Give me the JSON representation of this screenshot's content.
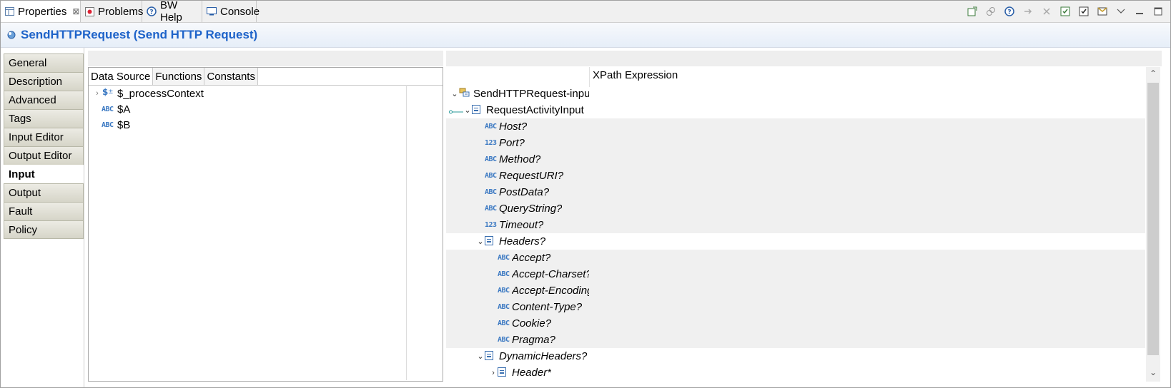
{
  "tabs": [
    {
      "label": "Properties",
      "icon": "properties-icon",
      "closable": true,
      "active": true
    },
    {
      "label": "Problems",
      "icon": "problems-icon",
      "closable": false,
      "active": false
    },
    {
      "label": "BW Help",
      "icon": "help-icon",
      "closable": false,
      "active": false
    },
    {
      "label": "Console",
      "icon": "console-icon",
      "closable": false,
      "active": false
    }
  ],
  "close_glyph": "⊠",
  "toolbar_icons": [
    "pin-icon",
    "link-icon",
    "help-icon",
    "forward-icon",
    "close-all-icon",
    "save-icon",
    "check-icon",
    "filter-icon",
    "view-menu-icon",
    "minimize-icon",
    "maximize-icon"
  ],
  "title": "SendHTTPRequest (Send HTTP Request)",
  "side_tabs": [
    "General",
    "Description",
    "Advanced",
    "Tags",
    "Input Editor",
    "Output Editor",
    "Input",
    "Output",
    "Fault",
    "Policy"
  ],
  "selected_side_tab": "Input",
  "left_pane": {
    "subtabs": [
      "Data Source",
      "Functions",
      "Constants"
    ],
    "active_subtab": "Data Source",
    "tree": [
      {
        "label": "$_processContext",
        "icon": "context-var-icon",
        "expandable": true
      },
      {
        "label": "$A",
        "icon": "string-type-icon",
        "expandable": false
      },
      {
        "label": "$B",
        "icon": "string-type-icon",
        "expandable": false
      }
    ]
  },
  "right_pane": {
    "column_header": "XPath Expression",
    "type_glyphs": {
      "string": "ABC",
      "number": "123"
    },
    "tree": [
      {
        "label": "SendHTTPRequest-input",
        "type": "root",
        "chev": "⌄",
        "indent": 0,
        "shade": false,
        "italic": false
      },
      {
        "label": "RequestActivityInput",
        "type": "element",
        "chev": "⌄",
        "indent": 1,
        "shade": false,
        "italic": false,
        "mapped": true
      },
      {
        "label": "Host?",
        "type": "string",
        "indent": 2,
        "shade": true,
        "italic": true
      },
      {
        "label": "Port?",
        "type": "number",
        "indent": 2,
        "shade": true,
        "italic": true
      },
      {
        "label": "Method?",
        "type": "string",
        "indent": 2,
        "shade": true,
        "italic": true
      },
      {
        "label": "RequestURI?",
        "type": "string",
        "indent": 2,
        "shade": true,
        "italic": true
      },
      {
        "label": "PostData?",
        "type": "string",
        "indent": 2,
        "shade": true,
        "italic": true
      },
      {
        "label": "QueryString?",
        "type": "string",
        "indent": 2,
        "shade": true,
        "italic": true
      },
      {
        "label": "Timeout?",
        "type": "number",
        "indent": 2,
        "shade": true,
        "italic": true
      },
      {
        "label": "Headers?",
        "type": "element",
        "chev": "⌄",
        "indent": 2,
        "shade": false,
        "italic": true
      },
      {
        "label": "Accept?",
        "type": "string",
        "indent": 3,
        "shade": true,
        "italic": true
      },
      {
        "label": "Accept-Charset?",
        "type": "string",
        "indent": 3,
        "shade": true,
        "italic": true
      },
      {
        "label": "Accept-Encoding?",
        "type": "string",
        "indent": 3,
        "shade": true,
        "italic": true
      },
      {
        "label": "Content-Type?",
        "type": "string",
        "indent": 3,
        "shade": true,
        "italic": true
      },
      {
        "label": "Cookie?",
        "type": "string",
        "indent": 3,
        "shade": true,
        "italic": true
      },
      {
        "label": "Pragma?",
        "type": "string",
        "indent": 3,
        "shade": true,
        "italic": true
      },
      {
        "label": "DynamicHeaders?",
        "type": "element",
        "chev": "⌄",
        "indent": 2,
        "shade": false,
        "italic": true
      },
      {
        "label": "Header*",
        "type": "element",
        "chev": "›",
        "indent": 3,
        "shade": false,
        "italic": true
      }
    ]
  },
  "scroll": {
    "up": "⌃",
    "down": "⌄"
  }
}
